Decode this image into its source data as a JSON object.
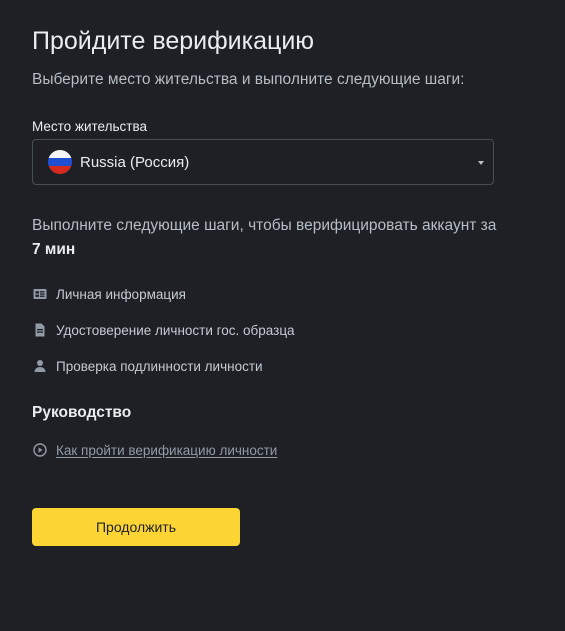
{
  "page": {
    "title": "Пройдите верификацию",
    "subtitle": "Выберите место жительства и выполните следующие шаги:"
  },
  "residence": {
    "label": "Место жительства",
    "selected": "Russia (Россия)",
    "flag_icon": "russia-flag-icon"
  },
  "steps_intro": {
    "text": "Выполните следующие шаги, чтобы верифицировать аккаунт за ",
    "time": "7 мин"
  },
  "steps": [
    {
      "icon": "id-card-icon",
      "label": "Личная информация"
    },
    {
      "icon": "document-icon",
      "label": "Удостоверение личности гос. образца"
    },
    {
      "icon": "person-icon",
      "label": "Проверка подлинности личности"
    }
  ],
  "guide": {
    "title": "Руководство",
    "link_label": "Как пройти верификацию личности",
    "link_icon": "play-circle-icon"
  },
  "actions": {
    "continue_label": "Продолжить"
  },
  "colors": {
    "background": "#1e2026",
    "accent": "#fcd535",
    "primary_text": "#eaecef",
    "secondary_text": "#b7bdc6"
  }
}
